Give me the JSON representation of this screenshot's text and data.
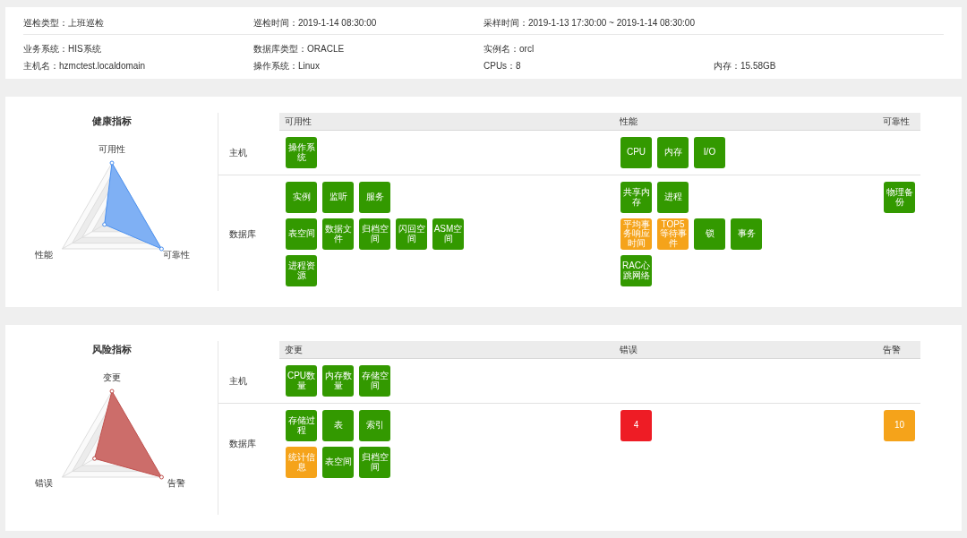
{
  "info": {
    "rows": [
      [
        "巡检类型：上班巡检",
        "巡检时间：2019-1-14 08:30:00",
        "采样时间：2019-1-13 17:30:00 ~ 2019-1-14 08:30:00"
      ],
      [
        "业务系统：HIS系统",
        "数据库类型：ORACLE",
        "实例名：orcl"
      ],
      [
        "主机名：hzmctest.localdomain",
        "操作系统：Linux",
        "CPUs：8",
        "内存：15.58GB"
      ]
    ]
  },
  "panels": [
    {
      "title": "健康指标",
      "kind": "health",
      "axes": [
        "可用性",
        "可靠性",
        "性能"
      ],
      "columns": [
        "可用性",
        "性能",
        "可靠性"
      ],
      "rows": [
        {
          "label": "主机",
          "cells": [
            [
              [
                {
                  "label": "操作系统",
                  "color": "#339900"
                }
              ]
            ],
            [
              [
                {
                  "label": "CPU",
                  "color": "#339900"
                },
                {
                  "label": "内存",
                  "color": "#339900"
                },
                {
                  "label": "I/O",
                  "color": "#339900"
                }
              ]
            ],
            []
          ]
        },
        {
          "label": "数据库",
          "cells": [
            [
              [
                {
                  "label": "实例",
                  "color": "#339900"
                },
                {
                  "label": "监听",
                  "color": "#339900"
                },
                {
                  "label": "服务",
                  "color": "#339900"
                }
              ],
              [
                {
                  "label": "表空间",
                  "color": "#339900"
                },
                {
                  "label": "数据文件",
                  "color": "#339900"
                },
                {
                  "label": "归档空间",
                  "color": "#339900"
                },
                {
                  "label": "闪回空间",
                  "color": "#339900"
                },
                {
                  "label": "ASM空间",
                  "color": "#339900"
                }
              ],
              [
                {
                  "label": "进程资源",
                  "color": "#339900"
                }
              ]
            ],
            [
              [
                {
                  "label": "共享内存",
                  "color": "#339900"
                },
                {
                  "label": "进程",
                  "color": "#339900"
                }
              ],
              [
                {
                  "label": "平均事务响应时间",
                  "color": "#f5a31a"
                },
                {
                  "label": "TOP5等待事件",
                  "color": "#f5a31a"
                },
                {
                  "label": "锁",
                  "color": "#339900"
                },
                {
                  "label": "事务",
                  "color": "#339900"
                }
              ],
              [
                {
                  "label": "RAC心跳网络",
                  "color": "#339900"
                }
              ]
            ],
            [
              [
                {
                  "label": "物理备份",
                  "color": "#339900"
                }
              ]
            ]
          ]
        }
      ]
    },
    {
      "title": "风险指标",
      "kind": "risk",
      "axes": [
        "变更",
        "告警",
        "错误"
      ],
      "columns": [
        "变更",
        "错误",
        "告警"
      ],
      "rows": [
        {
          "label": "主机",
          "cells": [
            [
              [
                {
                  "label": "CPU数量",
                  "color": "#339900"
                },
                {
                  "label": "内存数量",
                  "color": "#339900"
                },
                {
                  "label": "存储空间",
                  "color": "#339900"
                }
              ]
            ],
            [],
            []
          ]
        },
        {
          "label": "数据库",
          "cells": [
            [
              [
                {
                  "label": "存储过程",
                  "color": "#339900"
                },
                {
                  "label": "表",
                  "color": "#339900"
                },
                {
                  "label": "索引",
                  "color": "#339900"
                }
              ],
              [
                {
                  "label": "统计信息",
                  "color": "#f5a31a"
                },
                {
                  "label": "表空间",
                  "color": "#339900"
                },
                {
                  "label": "归档空间",
                  "color": "#339900"
                }
              ]
            ],
            [
              [
                {
                  "label": "4",
                  "color": "#ee1c25"
                }
              ]
            ],
            [
              [
                {
                  "label": "10",
                  "color": "#f5a31a"
                }
              ]
            ]
          ]
        }
      ]
    }
  ]
}
